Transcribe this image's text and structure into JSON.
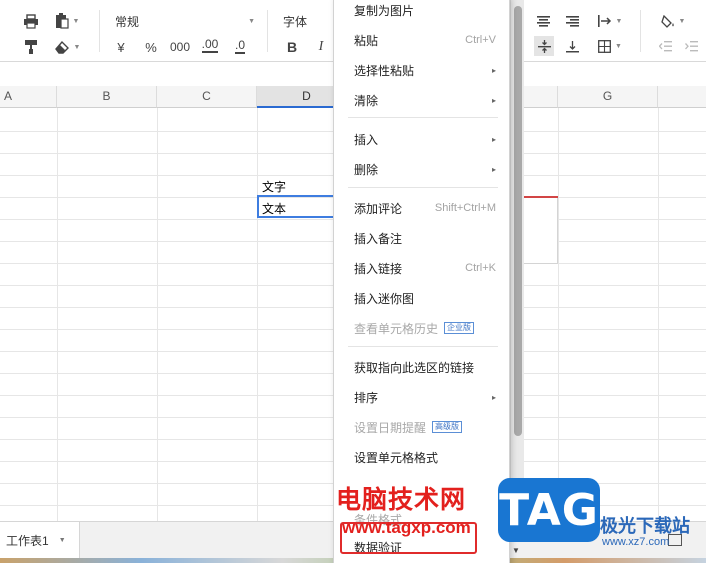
{
  "toolbar": {
    "number_format": "常规",
    "font_name": "字体",
    "currency": "¥",
    "percent": "%",
    "thousands": "000",
    "increase_decimal": ".00",
    "decrease_decimal": ".0",
    "bold": "B",
    "italic": "I"
  },
  "sheet": {
    "columns": [
      "A",
      "B",
      "C",
      "D",
      "G"
    ],
    "selected_column": "D",
    "cells": {
      "d4": "文字",
      "d5": "文本"
    }
  },
  "menu": {
    "items": [
      {
        "label": "复制为图片"
      },
      {
        "label": "粘贴",
        "shortcut": "Ctrl+V"
      },
      {
        "label": "选择性粘贴",
        "submenu": "▸"
      },
      {
        "label": "清除",
        "submenu": "▸"
      },
      {
        "label": "插入",
        "submenu": "▸"
      },
      {
        "label": "删除",
        "submenu": "▸"
      },
      {
        "label": "添加评论",
        "shortcut": "Shift+Ctrl+M"
      },
      {
        "label": "插入备注"
      },
      {
        "label": "插入链接",
        "shortcut": "Ctrl+K"
      },
      {
        "label": "插入迷你图"
      },
      {
        "label": "查看单元格历史",
        "badge": "企业版"
      },
      {
        "label": "获取指向此选区的链接"
      },
      {
        "label": "排序",
        "submenu": "▸"
      },
      {
        "label": "设置日期提醒",
        "badge": "高级版"
      },
      {
        "label": "设置单元格格式"
      },
      {
        "label": "条件格式"
      },
      {
        "label": "数据验证"
      }
    ]
  },
  "bottom": {
    "sheet_tab": "工作表1"
  },
  "watermark": {
    "left_title": "电脑技术网",
    "left_url": "www.tagxp.com",
    "logo": "TAG",
    "right_title": "极光下载站",
    "right_url": "www.xz7.com"
  },
  "colors": {
    "accent": "#3e7de0",
    "highlight": "#e02b2b",
    "logo_bg": "#1976d2"
  }
}
